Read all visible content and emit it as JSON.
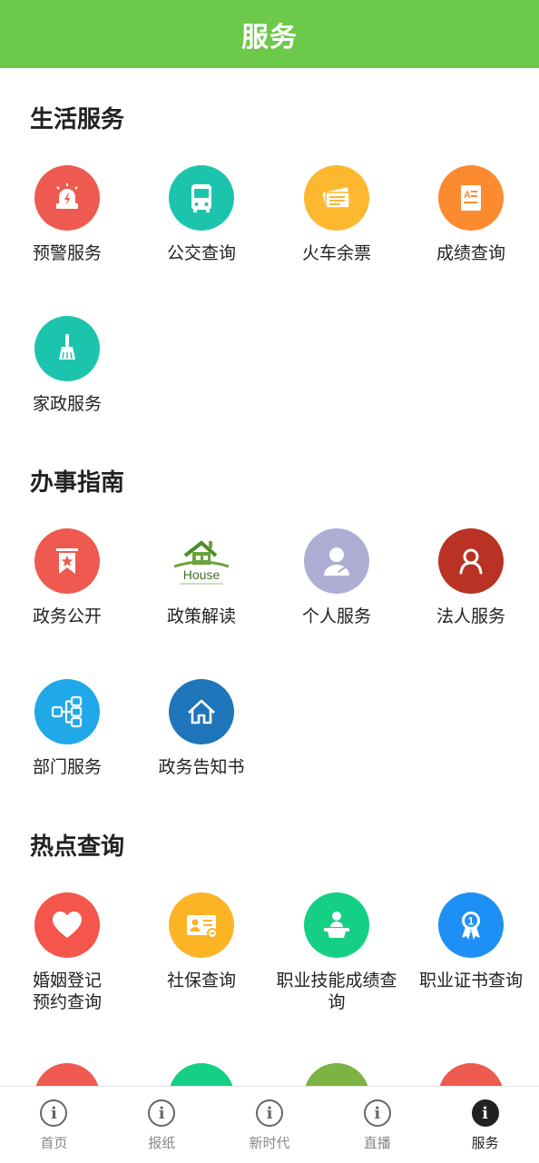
{
  "header": {
    "title": "服务"
  },
  "sections": {
    "life": {
      "title": "生活服务",
      "items": [
        "预警服务",
        "公交查询",
        "火车余票",
        "成绩查询",
        "家政服务"
      ]
    },
    "guide": {
      "title": "办事指南",
      "items": [
        "政务公开",
        "政策解读",
        "个人服务",
        "法人服务",
        "部门服务",
        "政务告知书"
      ],
      "house_logo_text": "House"
    },
    "hot": {
      "title": "热点查询",
      "items": [
        "婚姻登记\n预约查询",
        "社保查询",
        "职业技能成绩查询",
        "职业证书查询"
      ]
    }
  },
  "icons": {
    "alarm": "alarm-icon",
    "bus": "bus-icon",
    "ticket": "ticket-icon",
    "grade": "grade-icon",
    "broom": "broom-icon",
    "bookmark": "bookmark-star-icon",
    "house": "house-logo-icon",
    "person": "person-icon",
    "legal": "legal-person-icon",
    "dept": "org-chart-icon",
    "home": "home-outline-icon",
    "heart": "heart-icon",
    "id_card": "id-card-icon",
    "speaker": "podium-icon",
    "medal": "medal-icon"
  },
  "colors": {
    "header_green": "#6cc94a",
    "red": "#ee5a4f",
    "teal": "#1dc4ad",
    "yellow": "#fdb82f",
    "orange": "#fc8a2e",
    "lavender": "#aeaed4",
    "dark_red": "#b93224",
    "sky": "#20a8e9",
    "blue": "#1f75b9",
    "coral": "#f4554c",
    "amber": "#fcb425",
    "green": "#15cf85",
    "azure": "#1e90f5"
  },
  "tabbar": {
    "items": [
      {
        "label": "首页",
        "active": false
      },
      {
        "label": "报纸",
        "active": false
      },
      {
        "label": "新时代",
        "active": false
      },
      {
        "label": "直播",
        "active": false
      },
      {
        "label": "服务",
        "active": true
      }
    ],
    "icon_glyph": "i"
  }
}
